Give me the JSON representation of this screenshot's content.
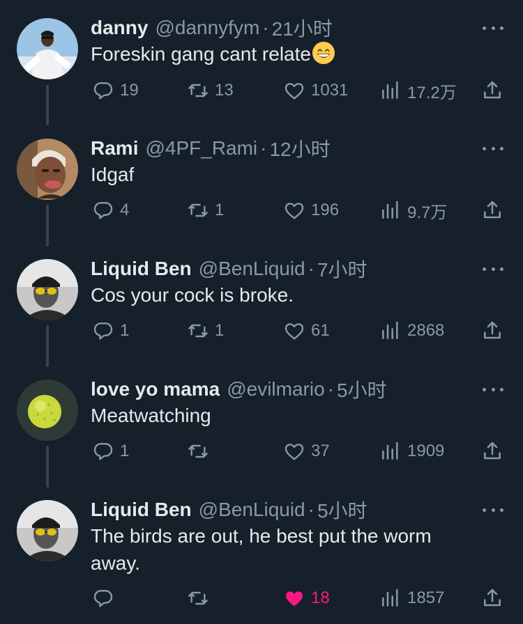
{
  "tweets": [
    {
      "name": "danny",
      "handle": "@dannyfym",
      "separator": "·",
      "time": "21小时",
      "text": "Foreskin gang cant relate",
      "emoji": "grinning-face-with-smiling-eyes",
      "replies": "19",
      "retweets": "13",
      "likes": "1031",
      "views": "17.2万",
      "liked": false
    },
    {
      "name": "Rami",
      "handle": "@4PF_Rami",
      "separator": "·",
      "time": "12小时",
      "text": "Idgaf",
      "replies": "4",
      "retweets": "1",
      "likes": "196",
      "views": "9.7万",
      "liked": false
    },
    {
      "name": "Liquid Ben",
      "handle": "@BenLiquid",
      "separator": "·",
      "time": "7小时",
      "text": "Cos your cock is broke.",
      "replies": "1",
      "retweets": "1",
      "likes": "61",
      "views": "2868",
      "liked": false
    },
    {
      "name": "love yo mama",
      "handle": "@evilmario",
      "separator": "·",
      "time": "5小时",
      "text": "Meatwatching",
      "replies": "1",
      "retweets": "",
      "likes": "37",
      "views": "1909",
      "liked": false
    },
    {
      "name": "Liquid Ben",
      "handle": "@BenLiquid",
      "separator": "·",
      "time": "5小时",
      "text": "The birds are out, he best put the worm away.",
      "replies": "",
      "retweets": "",
      "likes": "18",
      "views": "1857",
      "liked": true
    }
  ],
  "colors": {
    "background": "#15202b",
    "text_primary": "#e7e9ea",
    "text_secondary": "#8b98a5",
    "thread_line": "#38444d",
    "like_active": "#f91880"
  },
  "icons": [
    "reply-icon",
    "retweet-icon",
    "like-icon",
    "views-icon",
    "share-icon",
    "more-icon"
  ]
}
